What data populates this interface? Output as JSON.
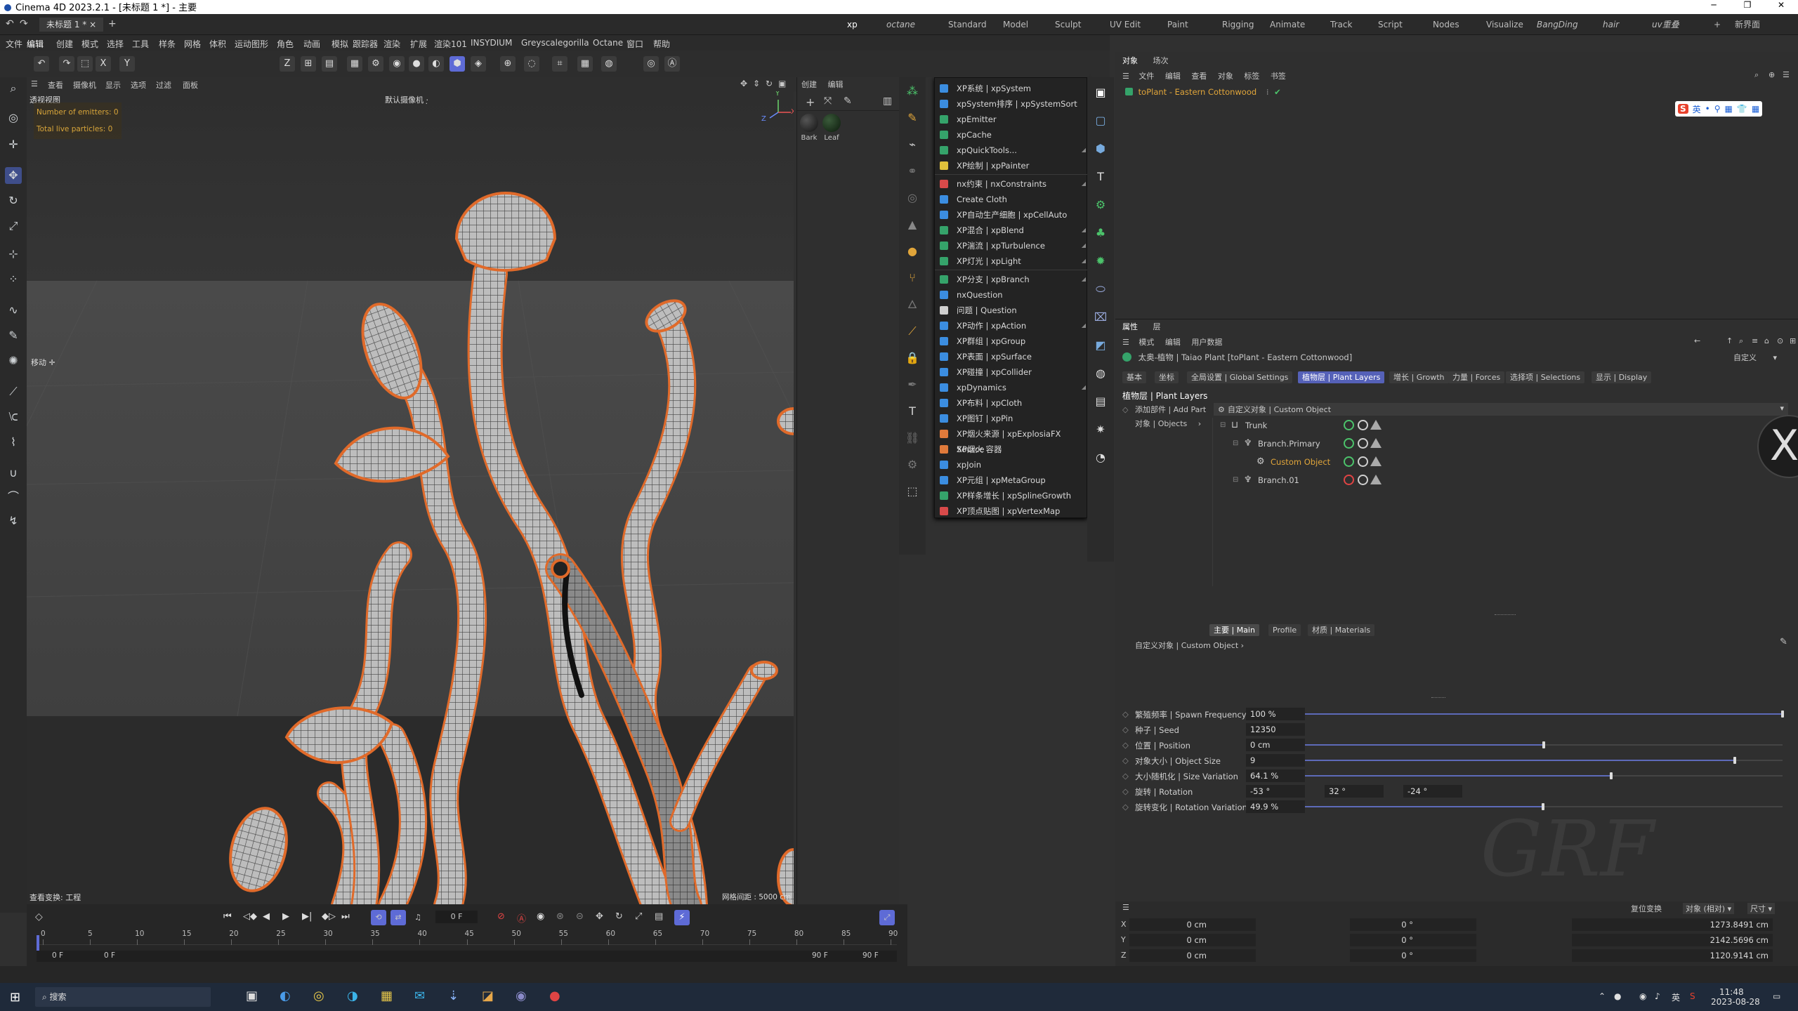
{
  "window": {
    "title": "Cinema 4D 2023.2.1 - [未标题 1 *] - 主要",
    "min": "─",
    "max": "❐",
    "close": "✕"
  },
  "tabs": {
    "doc": "未标题 1 *",
    "close": "×",
    "plus": "+"
  },
  "layouts": [
    {
      "label": "xp",
      "active": true
    },
    {
      "label": "octane",
      "italic": true
    },
    {
      "label": "Standard"
    },
    {
      "label": "Model"
    },
    {
      "label": "Sculpt"
    },
    {
      "label": "UV Edit"
    },
    {
      "label": "Paint"
    },
    {
      "label": "Rigging"
    },
    {
      "label": "Animate"
    },
    {
      "label": "Track"
    },
    {
      "label": "Script"
    },
    {
      "label": "Nodes"
    },
    {
      "label": "Visualize"
    },
    {
      "label": "BangDing",
      "italic": true
    },
    {
      "label": "hair",
      "italic": true
    },
    {
      "label": "uv重叠",
      "italic": true
    },
    {
      "label": "+"
    },
    {
      "label": "新界面"
    }
  ],
  "menu": [
    "文件",
    "编辑",
    "创建",
    "模式",
    "选择",
    "工具",
    "样条",
    "网格",
    "体积",
    "运动图形",
    "角色",
    "动画",
    "模拟",
    "跟踪器",
    "渲染",
    "扩展",
    "渲染101",
    "INSYDIUM",
    "Greyscalegorilla",
    "Octane",
    "窗口",
    "帮助"
  ],
  "toolbar_icons": [
    "undo-icon",
    "redo-icon",
    "live-select-icon",
    "x-axis-icon",
    "y-axis-icon",
    "z-axis-icon",
    "coord-system-icon",
    "render-view-icon",
    "render-picture-viewer-icon",
    "render-settings-icon",
    "object-mode-icon",
    "point-mode-icon",
    "edge-mode-icon",
    "polygon-mode-icon",
    "uv-mode-icon",
    "axis-mode-icon",
    "snap-icon",
    "grid-snap-icon",
    "workplane-icon",
    "deform-icon",
    "dynamics-icon",
    "camera-icon"
  ],
  "toolbar_glyphs": [
    "↶",
    "↷",
    "⬚",
    "X",
    "Y",
    "Z",
    "⊞",
    "▤",
    "▦",
    "⚙",
    "◉",
    "●",
    "◐",
    "⬢",
    "◈",
    "⊕",
    "◌",
    "⌗",
    "▦",
    "◍",
    "◎",
    "Ⓐ"
  ],
  "viewport": {
    "menus": [
      "查看",
      "摄像机",
      "显示",
      "选项",
      "过滤",
      "面板"
    ],
    "label": "透视视图",
    "camera": "默认摄像机 ·̣",
    "hud": [
      "Number of emitters: 0",
      "Total live particles: 0"
    ],
    "move_tip": "移动 ✛",
    "status_left": "查看变换: 工程",
    "status_right": "网格间距 : 5000 cm",
    "axes": [
      "Y",
      "X",
      "Z"
    ]
  },
  "materials": {
    "menus": [
      "创建",
      "编辑"
    ],
    "items": [
      {
        "name": "Bark"
      },
      {
        "name": "Leaf"
      }
    ]
  },
  "dropdown": [
    {
      "label": "XP系统 | xpSystem",
      "color": "#3b8de0"
    },
    {
      "label": "xpSystem排序 | xpSystemSort",
      "color": "#3b8de0"
    },
    {
      "label": "xpEmitter",
      "color": "#35a36a"
    },
    {
      "label": "xpCache",
      "color": "#35a36a"
    },
    {
      "label": "xpQuickTools...",
      "color": "#35a36a",
      "arrow": true
    },
    {
      "label": "XP绘制 | xpPainter",
      "color": "#e0c13b"
    },
    {
      "label": "nx约束 | nxConstraints",
      "color": "#d84a4a",
      "arrow": true,
      "sep": true
    },
    {
      "label": "Create Cloth",
      "color": "#3b8de0"
    },
    {
      "label": "XP自动生产细胞 | xpCellAuto",
      "color": "#3b8de0"
    },
    {
      "label": "XP混合 | xpBlend",
      "color": "#35a36a",
      "arrow": true
    },
    {
      "label": "XP湍流 | xpTurbulence",
      "color": "#35a36a",
      "arrow": true
    },
    {
      "label": "XP灯光 | xpLight",
      "color": "#35a36a",
      "arrow": true
    },
    {
      "label": "XP分支 | xpBranch",
      "color": "#35a36a",
      "arrow": true,
      "sep": true
    },
    {
      "label": "nxQuestion",
      "color": "#3b8de0"
    },
    {
      "label": "问题 | Question",
      "color": "#cfcfcf"
    },
    {
      "label": "XP动作 | xpAction",
      "color": "#3b8de0",
      "arrow": true
    },
    {
      "label": "XP群组 | xpGroup",
      "color": "#3b8de0"
    },
    {
      "label": "XP表面 | xpSurface",
      "color": "#3b8de0"
    },
    {
      "label": "XP碰撞 | xpCollider",
      "color": "#3b8de0"
    },
    {
      "label": "xpDynamics",
      "color": "#3b8de0",
      "arrow": true
    },
    {
      "label": "XP布料 | xpCloth",
      "color": "#3b8de0"
    },
    {
      "label": "XP图钉 | xpPin",
      "color": "#3b8de0"
    },
    {
      "label": "XP烟火来源 | xpExplosiaFX Source",
      "color": "#e07a3b"
    },
    {
      "label": "XP烟火 容器",
      "color": "#e07a3b"
    },
    {
      "label": "xpJoin",
      "color": "#3b8de0"
    },
    {
      "label": "XP元组 | xpMetaGroup",
      "color": "#3b8de0"
    },
    {
      "label": "XP样条增长 | xpSplineGrowth",
      "color": "#35a36a"
    },
    {
      "label": "XP顶点贴图 | xpVertexMap",
      "color": "#d84a4a"
    }
  ],
  "objects": {
    "tabs": [
      "对象",
      "场次"
    ],
    "menus": [
      "文件",
      "编辑",
      "查看",
      "对象",
      "标签",
      "书签"
    ],
    "items": [
      {
        "label": "toPlant - Eastern Cottonwood"
      }
    ],
    "ime": [
      "英",
      "•",
      "⚲",
      "▦",
      "👕",
      "▦"
    ]
  },
  "attributes": {
    "tabs": [
      "属性",
      "层"
    ],
    "menus": [
      "模式",
      "编辑",
      "用户数据"
    ],
    "header": "太奥-植物 | Taiao Plant [toPlant - Eastern Cottonwood]",
    "preset": "自定义",
    "subtabs": [
      {
        "label": "基本"
      },
      {
        "label": "坐标"
      },
      {
        "label": "全局设置 | Global Settings"
      },
      {
        "label": "植物层 | Plant Layers",
        "active": true
      },
      {
        "label": "增长 | Growth"
      },
      {
        "label": "力量 | Forces"
      },
      {
        "label": "选择项 | Selections"
      },
      {
        "label": "显示 | Display"
      }
    ],
    "section": "植物层 | Plant Layers",
    "add_part": "添加部件 | Add Part",
    "custom_object_btn": "自定义对象 | Custom Object",
    "objects_label": "对象 | Objects",
    "tree": [
      {
        "label": "Trunk",
        "indent": 0,
        "state": "ok"
      },
      {
        "label": "Branch.Primary",
        "indent": 1,
        "state": "ok"
      },
      {
        "label": "Custom Object",
        "indent": 2,
        "state": "ok",
        "highlight": true
      },
      {
        "label": "Branch.01",
        "indent": 1,
        "state": "off"
      }
    ],
    "bottom_tabs": [
      {
        "label": "主要 | Main",
        "active": true
      },
      {
        "label": "Profile"
      },
      {
        "label": "材质 | Materials"
      }
    ],
    "custom_object_link": "自定义对象 | Custom Object ›",
    "props": [
      {
        "label": "繁殖频率 | Spawn Frequency",
        "value": "100 %",
        "slider": 1.0
      },
      {
        "label": "种子 | Seed",
        "value": "12350"
      },
      {
        "label": "位置 | Position",
        "value": "0 cm",
        "slider": 0.5
      },
      {
        "label": "对象大小 | Object Size",
        "value": "9",
        "slider": 0.9
      },
      {
        "label": "大小随机化 | Size Variation",
        "value": "64.1 %",
        "slider": 0.641
      },
      {
        "label": "旋转 | Rotation",
        "value": "-53 °",
        "value2": "32 °",
        "value3": "-24 °"
      },
      {
        "label": "旋转变化 | Rotation Variation",
        "value": "49.9 %",
        "slider": 0.499
      }
    ]
  },
  "coords": {
    "buttons": [
      "复位变换",
      "对象 (相对) ▾",
      "尺寸 ▾"
    ],
    "rows": [
      {
        "axis": "X",
        "pos": "0 cm",
        "rot": "0 °",
        "size": "1273.8491 cm"
      },
      {
        "axis": "Y",
        "pos": "0 cm",
        "rot": "0 °",
        "size": "2142.5696 cm"
      },
      {
        "axis": "Z",
        "pos": "0 cm",
        "rot": "0 °",
        "size": "1120.9141 cm"
      }
    ]
  },
  "timeline": {
    "current": "0 F",
    "start": "0 F",
    "start2": "0 F",
    "end": "90 F",
    "end2": "90 F",
    "ticks": [
      "0",
      "5",
      "10",
      "15",
      "20",
      "25",
      "30",
      "35",
      "40",
      "45",
      "50",
      "55",
      "60",
      "65",
      "70",
      "75",
      "80",
      "85",
      "90"
    ]
  },
  "taskbar": {
    "search": "搜索",
    "time": "11:48",
    "date": "2023-08-28",
    "ime": "英"
  },
  "colors": {
    "accent": "#5e6bd6",
    "highlight_orange": "#e06a2a",
    "ok_green": "#4cc36b",
    "error_red": "#e04444"
  }
}
